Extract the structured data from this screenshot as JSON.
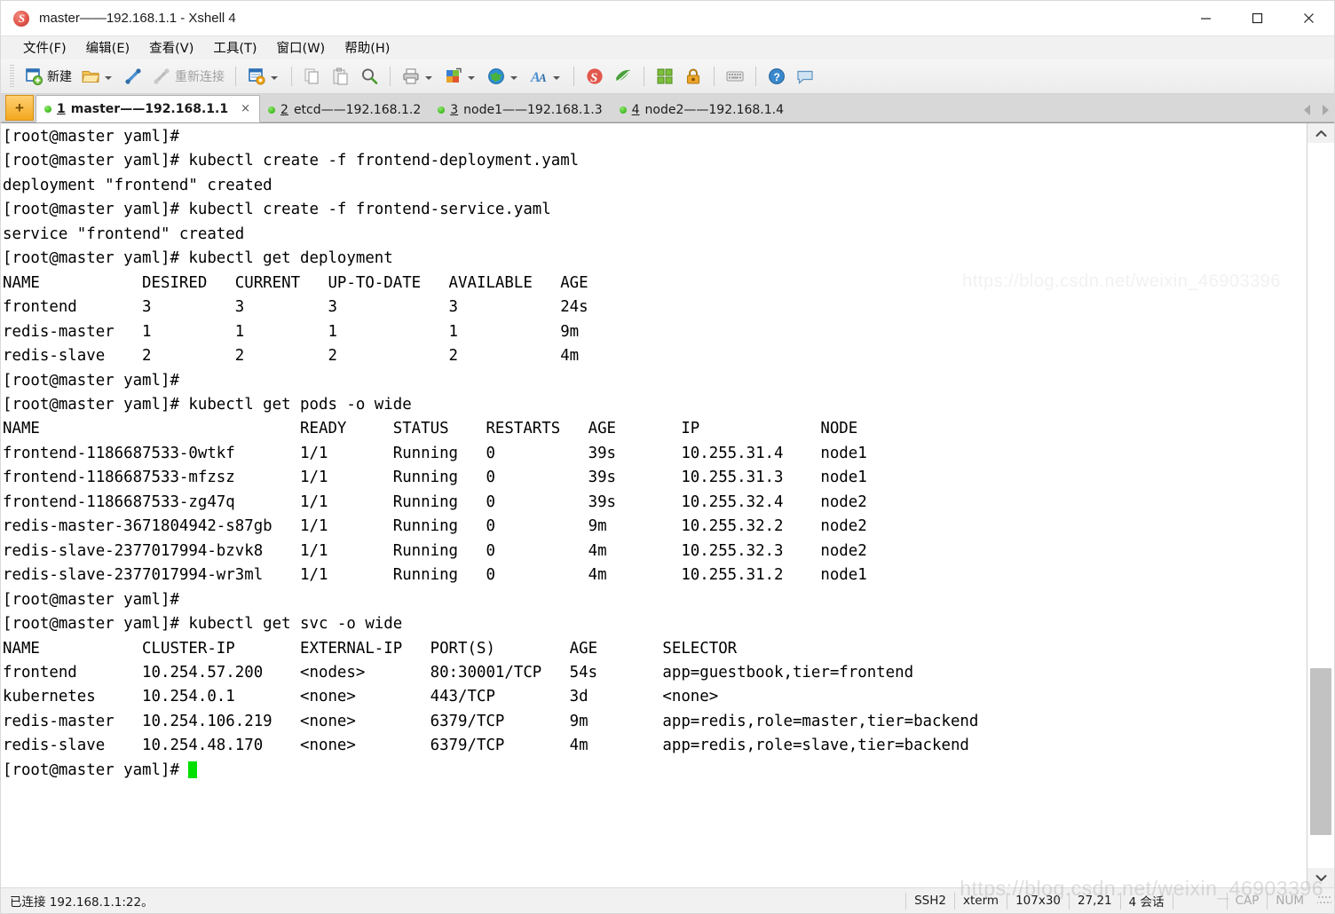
{
  "window": {
    "title": "master——192.168.1.1 - Xshell 4",
    "app_icon": "xshell-icon",
    "minimize_label": "—",
    "maximize_label": "□",
    "close_label": "✕"
  },
  "menu": {
    "items": [
      {
        "label": "文件(F)"
      },
      {
        "label": "编辑(E)"
      },
      {
        "label": "查看(V)"
      },
      {
        "label": "工具(T)"
      },
      {
        "label": "窗口(W)"
      },
      {
        "label": "帮助(H)"
      }
    ]
  },
  "toolbar": {
    "new_label": "新建",
    "reconnect_label": "重新连接",
    "icons": [
      "new-session-icon",
      "open-folder-icon",
      "connect-icon",
      "disconnect-icon",
      "session-properties-icon",
      "copy-icon",
      "paste-icon",
      "find-icon",
      "print-icon",
      "color-scheme-icon",
      "web-browser-icon",
      "font-icon",
      "xshell-icon",
      "xftp-icon",
      "arrange-icon",
      "lock-icon",
      "keyboard-icon",
      "help-icon",
      "feedback-icon"
    ]
  },
  "tabs": {
    "new_tab_label": "+",
    "items": [
      {
        "num": "1",
        "label": "master——192.168.1.1",
        "active": true,
        "status": "connected"
      },
      {
        "num": "2",
        "label": "etcd——192.168.1.2",
        "active": false,
        "status": "connected"
      },
      {
        "num": "3",
        "label": "node1——192.168.1.3",
        "active": false,
        "status": "connected"
      },
      {
        "num": "4",
        "label": "node2——192.168.1.4",
        "active": false,
        "status": "connected"
      }
    ],
    "close_label": "×"
  },
  "terminal": {
    "prompt": "[root@master yaml]# ",
    "lines": [
      "[root@master yaml]#",
      "[root@master yaml]# kubectl create -f frontend-deployment.yaml",
      "deployment \"frontend\" created",
      "[root@master yaml]# kubectl create -f frontend-service.yaml",
      "service \"frontend\" created",
      "[root@master yaml]# kubectl get deployment",
      "NAME           DESIRED   CURRENT   UP-TO-DATE   AVAILABLE   AGE",
      "frontend       3         3         3            3           24s",
      "redis-master   1         1         1            1           9m",
      "redis-slave    2         2         2            2           4m",
      "[root@master yaml]#",
      "[root@master yaml]# kubectl get pods -o wide",
      "NAME                            READY     STATUS    RESTARTS   AGE       IP             NODE",
      "frontend-1186687533-0wtkf       1/1       Running   0          39s       10.255.31.4    node1",
      "frontend-1186687533-mfzsz       1/1       Running   0          39s       10.255.31.3    node1",
      "frontend-1186687533-zg47q       1/1       Running   0          39s       10.255.32.4    node2",
      "redis-master-3671804942-s87gb   1/1       Running   0          9m        10.255.32.2    node2",
      "redis-slave-2377017994-bzvk8    1/1       Running   0          4m        10.255.32.3    node2",
      "redis-slave-2377017994-wr3ml    1/1       Running   0          4m        10.255.31.2    node1",
      "[root@master yaml]#",
      "[root@master yaml]# kubectl get svc -o wide",
      "NAME           CLUSTER-IP       EXTERNAL-IP   PORT(S)        AGE       SELECTOR",
      "frontend       10.254.57.200    <nodes>       80:30001/TCP   54s       app=guestbook,tier=frontend",
      "kubernetes     10.254.0.1       <none>        443/TCP        3d        <none>",
      "redis-master   10.254.106.219   <none>        6379/TCP       9m        app=redis,role=master,tier=backend",
      "redis-slave    10.254.48.170    <none>        6379/TCP       4m        app=redis,role=slave,tier=backend"
    ],
    "last_prompt": "[root@master yaml]# ",
    "cursor_color": "#00e000",
    "background": "#ffffff",
    "foreground": "#000000"
  },
  "statusbar": {
    "connection": "已连接 192.168.1.1:22。",
    "protocol": "SSH2",
    "term_type": "xterm",
    "size": "107x30",
    "cursor_pos": "27,21",
    "sessions": "4 会话",
    "cap": "CAP",
    "num": "NUM"
  },
  "watermark": {
    "text": "https://blog.csdn.net/weixin_46903396"
  }
}
